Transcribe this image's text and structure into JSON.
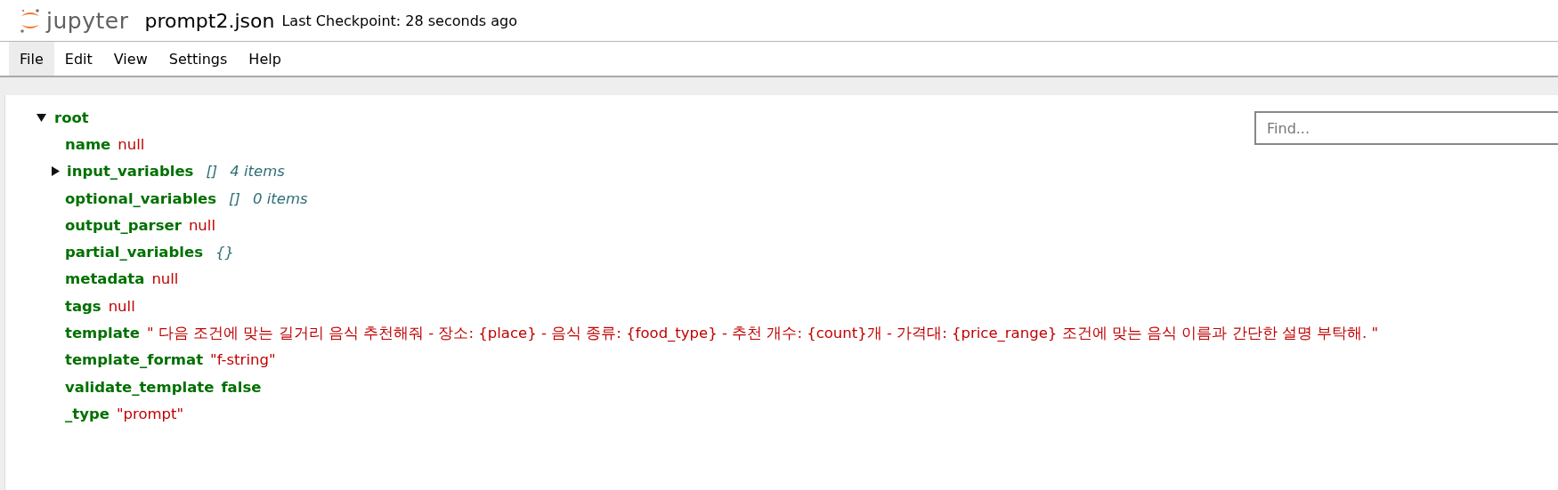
{
  "header": {
    "logo_text": "jupyter",
    "file_name": "prompt2.json",
    "checkpoint": "Last Checkpoint: 28 seconds ago"
  },
  "menu": [
    {
      "label": "File",
      "selected": true
    },
    {
      "label": "Edit",
      "selected": false
    },
    {
      "label": "View",
      "selected": false
    },
    {
      "label": "Settings",
      "selected": false
    },
    {
      "label": "Help",
      "selected": false
    }
  ],
  "find": {
    "placeholder": "Find..."
  },
  "tree": {
    "key": "root",
    "expanded": true,
    "children": [
      {
        "key": "name",
        "kind": "null",
        "value": "null"
      },
      {
        "key": "input_variables",
        "kind": "array",
        "expanded": false,
        "bracket": "[]",
        "count": "4 items"
      },
      {
        "key": "optional_variables",
        "kind": "array",
        "bracket": "[]",
        "count": "0 items"
      },
      {
        "key": "output_parser",
        "kind": "null",
        "value": "null"
      },
      {
        "key": "partial_variables",
        "kind": "object",
        "bracket": "{}"
      },
      {
        "key": "metadata",
        "kind": "null",
        "value": "null"
      },
      {
        "key": "tags",
        "kind": "null",
        "value": "null"
      },
      {
        "key": "template",
        "kind": "string",
        "value": "\" 다음 조건에 맞는 길거리 음식 추천해줘 - 장소: {place} - 음식 종류: {food_type} - 추천 개수: {count}개 - 가격대: {price_range} 조건에 맞는 음식 이름과 간단한 설명 부탁해. \""
      },
      {
        "key": "template_format",
        "kind": "string",
        "value": "\"f-string\""
      },
      {
        "key": "validate_template",
        "kind": "boolean",
        "value": "false"
      },
      {
        "key": "_type",
        "kind": "string",
        "value": "\"prompt\""
      }
    ]
  }
}
